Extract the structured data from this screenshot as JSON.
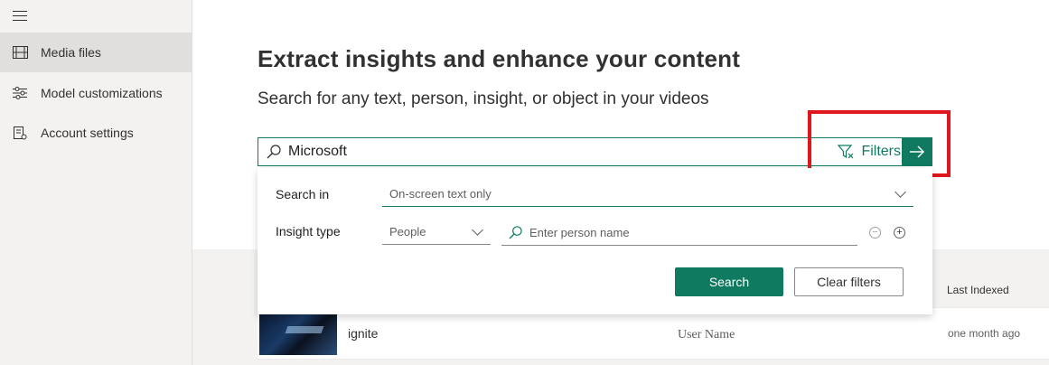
{
  "sidebar": {
    "items": [
      {
        "label": "Media files",
        "icon": "film-icon",
        "active": true
      },
      {
        "label": "Model customizations",
        "icon": "sliders-icon",
        "active": false
      },
      {
        "label": "Account settings",
        "icon": "settings-list-icon",
        "active": false
      }
    ]
  },
  "main": {
    "title": "Extract insights and enhance your content",
    "subtitle": "Search for any text, person, insight, or object in your videos"
  },
  "search": {
    "value": "Microsoft",
    "filters_label": "Filters"
  },
  "filters": {
    "search_in_label": "Search in",
    "search_in_value": "On-screen text only",
    "insight_type_label": "Insight type",
    "insight_type_value": "People",
    "person_placeholder": "Enter person name",
    "search_button": "Search",
    "clear_button": "Clear filters"
  },
  "table": {
    "last_indexed_header": "Last Indexed",
    "rows": [
      {
        "name": "ignite",
        "owner": "User Name",
        "last_indexed": "one month ago"
      }
    ]
  },
  "colors": {
    "accent": "#0f7a5f",
    "highlight": "#e0161d"
  }
}
